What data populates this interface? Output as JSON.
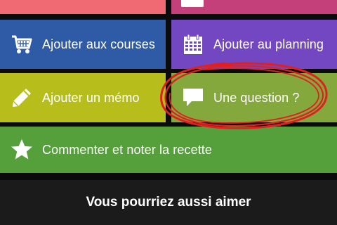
{
  "colors": {
    "background": "#0b0b0b",
    "top_left_tile": "#ef6a72",
    "top_right_tile": "#c4407b",
    "courses_tile": "#2f5aa6",
    "planning_tile": "#7347c2",
    "memo_tile": "#b7bd1a",
    "question_tile": "#84a83c",
    "comment_tile": "#55a03a",
    "footer": "#1b1b1b",
    "annotation_circle": "#e02020"
  },
  "tiles": {
    "courses": {
      "label": "Ajouter aux courses",
      "icon": "shopping-cart-icon"
    },
    "planning": {
      "label": "Ajouter au planning",
      "icon": "calendar-icon"
    },
    "memo": {
      "label": "Ajouter un mémo",
      "icon": "pencil-icon"
    },
    "question": {
      "label": "Une question ?",
      "icon": "speech-bubble-icon"
    },
    "comment": {
      "label": "Commenter et noter la recette",
      "icon": "star-icon"
    }
  },
  "footer": {
    "title": "Vous pourriez aussi aimer"
  }
}
